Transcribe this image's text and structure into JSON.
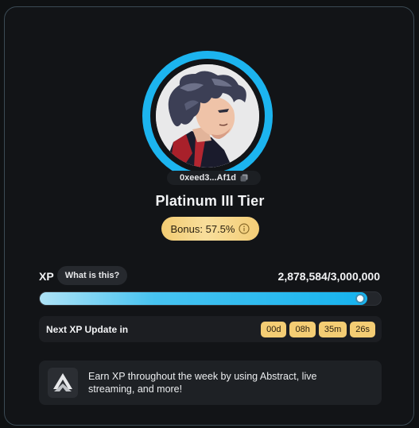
{
  "profile": {
    "address": "0xeed3...Af1d",
    "tier": "Platinum III Tier"
  },
  "bonus": {
    "label": "Bonus: 57.5%"
  },
  "xp": {
    "label": "XP",
    "help_button": "What is this?",
    "value_text": "2,878,584/3,000,000",
    "current": 2878584,
    "max": 3000000
  },
  "update": {
    "label": "Next XP Update in",
    "days": "00d",
    "hours": "08h",
    "minutes": "35m",
    "seconds": "26s"
  },
  "info": {
    "text": "Earn XP throughout the week by using Abstract, live streaming, and more!"
  },
  "colors": {
    "ring": "#1cb4ef",
    "gold": "#f4cd74",
    "background": "#121417"
  },
  "icons": {
    "copy": "copy-icon",
    "info": "info-icon",
    "logo": "abstract-logo-icon"
  }
}
